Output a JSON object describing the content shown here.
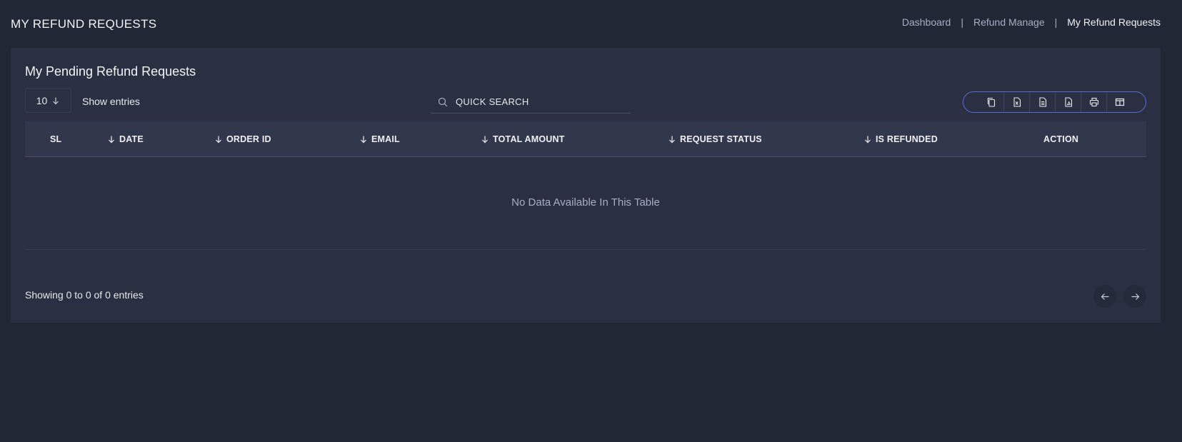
{
  "header": {
    "title": "MY REFUND REQUESTS",
    "breadcrumb": [
      "Dashboard",
      "Refund Manage",
      "My Refund Requests"
    ]
  },
  "card": {
    "title": "My Pending Refund Requests",
    "length_value": "10",
    "show_entries_label": "Show entries",
    "search_placeholder": "QUICK SEARCH",
    "export_buttons": [
      "copy-icon",
      "excel-icon",
      "csv-icon",
      "pdf-icon",
      "print-icon",
      "column-visibility-icon"
    ],
    "columns": [
      "SL",
      "DATE",
      "ORDER ID",
      "EMAIL",
      "TOTAL AMOUNT",
      "REQUEST STATUS",
      "IS REFUNDED",
      "ACTION"
    ],
    "empty_message": "No Data Available In This Table",
    "info": "Showing 0 to 0 of 0 entries"
  },
  "colors": {
    "background": "#222736",
    "card": "#2a3042",
    "accent": "#5a6ad6"
  }
}
